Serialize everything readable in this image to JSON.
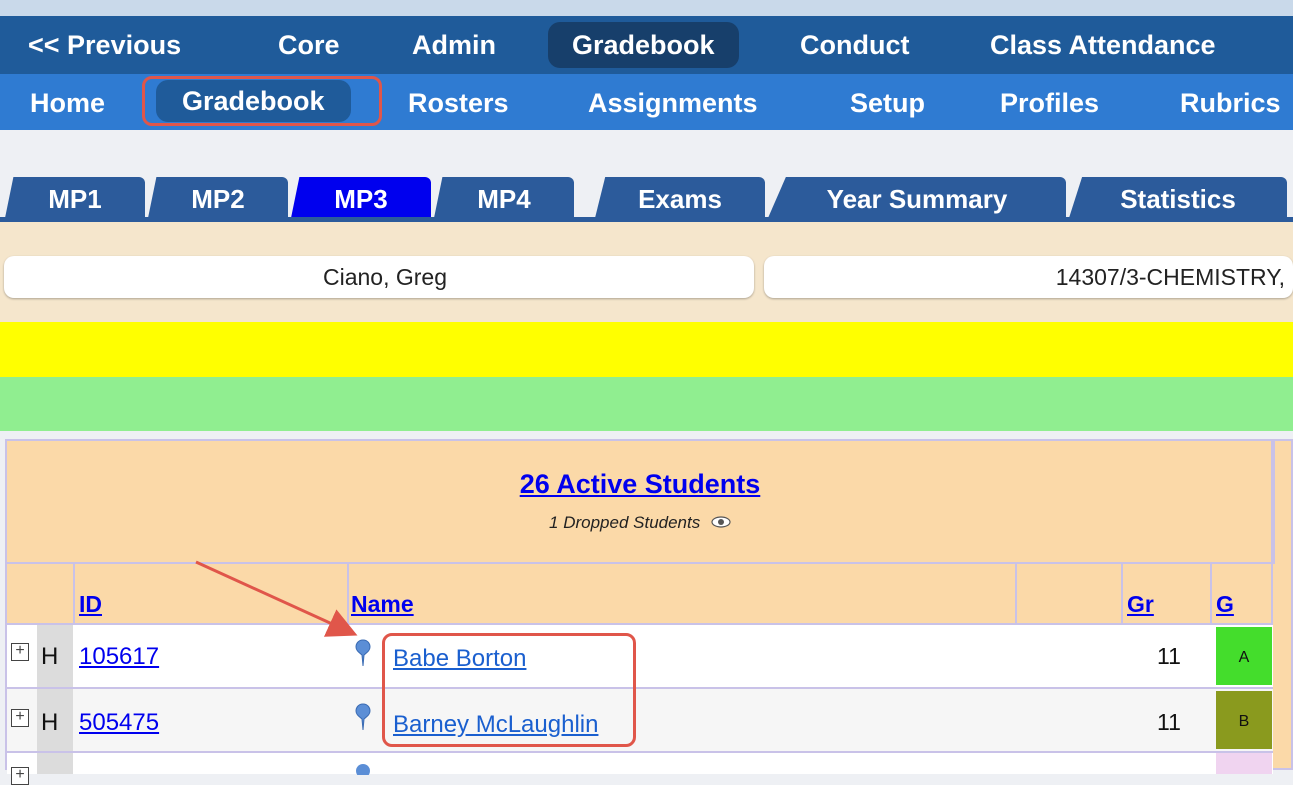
{
  "nav_primary": {
    "items": [
      {
        "label": "<< Previous"
      },
      {
        "label": "Core"
      },
      {
        "label": "Admin"
      },
      {
        "label": "Gradebook"
      },
      {
        "label": "Conduct"
      },
      {
        "label": "Class Attendance"
      }
    ],
    "active": "Gradebook"
  },
  "nav_secondary": {
    "items": [
      {
        "label": "Home"
      },
      {
        "label": "Gradebook"
      },
      {
        "label": "Rosters"
      },
      {
        "label": "Assignments"
      },
      {
        "label": "Setup"
      },
      {
        "label": "Profiles"
      },
      {
        "label": "Rubrics"
      }
    ],
    "active": "Gradebook"
  },
  "tabs": [
    {
      "label": "MP1"
    },
    {
      "label": "MP2"
    },
    {
      "label": "MP3"
    },
    {
      "label": "MP4"
    },
    {
      "label": "Exams"
    },
    {
      "label": "Year Summary"
    },
    {
      "label": "Statistics"
    }
  ],
  "selected_tab": "MP3",
  "teacher": "Ciano, Greg",
  "course": "14307/3-CHEMISTRY,",
  "students": {
    "active_label": "26 Active Students",
    "dropped_label": "1 Dropped Students"
  },
  "columns": {
    "id": "ID",
    "name": "Name",
    "gr": "Gr",
    "g": "G"
  },
  "rows": [
    {
      "flag": "H",
      "id": "105617",
      "name": "Babe Borton",
      "gr": "11",
      "g": "A",
      "g_color": "#44dd2c"
    },
    {
      "flag": "H",
      "id": "505475",
      "name": "Barney McLaughlin",
      "gr": "11",
      "g": "B",
      "g_color": "#8a9a1e"
    }
  ],
  "colors": {
    "nav_primary": "#1f5b9a",
    "nav_secondary": "#2f7bd2",
    "tab": "#2c5b9b",
    "tab_selected": "#0000ee",
    "highlight_box": "#e0564a",
    "yellow_bar": "#ffff00",
    "green_bar": "#90ee90",
    "table_header": "#fbd9a8"
  }
}
